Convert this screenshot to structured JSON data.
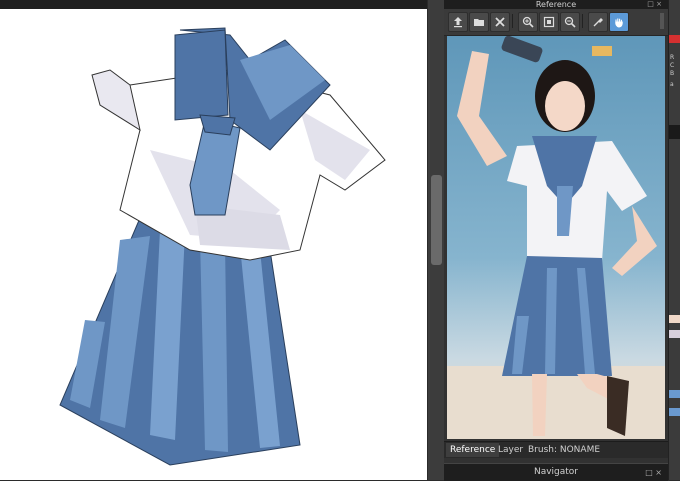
{
  "reference_panel": {
    "title": "Reference",
    "tabs": [
      "Reference",
      "Layer",
      "Brush: NONAME"
    ],
    "toolbar_icons": [
      "upload-icon",
      "open-folder-icon",
      "close-icon",
      "zoom-in-icon",
      "fit-to-window-icon",
      "zoom-out-icon",
      "eyedropper-icon",
      "hand-icon"
    ]
  },
  "navigator": {
    "title": "Navigator"
  },
  "right_strip_text": [
    "R",
    "C",
    "B",
    "a"
  ],
  "colors": {
    "uniform_blue": "#4f74a6",
    "uniform_light_blue": "#6f97c6",
    "shirt_shade": "#e3e2ec",
    "panel_bg": "#323232",
    "active_tool": "#5c9ad8"
  }
}
